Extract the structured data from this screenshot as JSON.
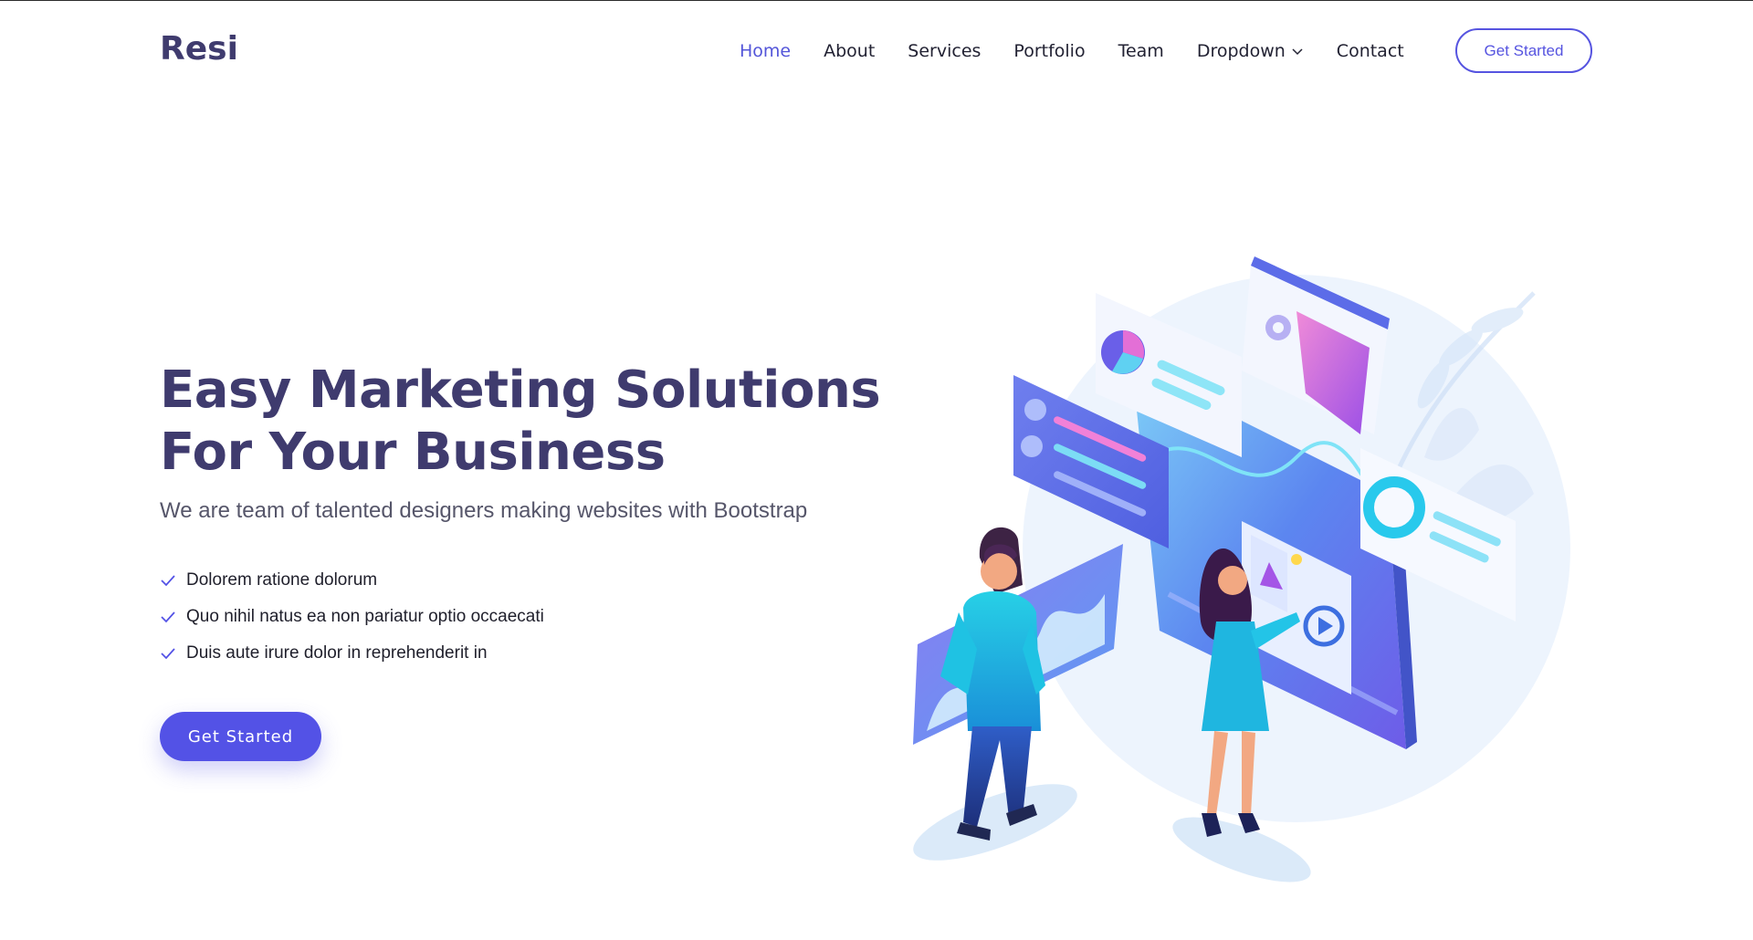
{
  "header": {
    "logo": "Resi",
    "nav": [
      {
        "label": "Home",
        "active": true
      },
      {
        "label": "About",
        "active": false
      },
      {
        "label": "Services",
        "active": false
      },
      {
        "label": "Portfolio",
        "active": false
      },
      {
        "label": "Team",
        "active": false
      },
      {
        "label": "Dropdown",
        "active": false,
        "has_dropdown": true
      },
      {
        "label": "Contact",
        "active": false
      }
    ],
    "cta_label": "Get Started"
  },
  "hero": {
    "title_line1": "Easy Marketing Solutions",
    "title_line2": "For Your Business",
    "subtitle": "We are team of talented designers making websites with Bootstrap",
    "checklist": [
      "Dolorem ratione dolorum",
      "Quo nihil natus ea non pariatur optio occaecati",
      "Duis aute irure dolor in reprehenderit in"
    ],
    "cta_label": "Get Started"
  },
  "colors": {
    "brand": "#3f3b6e",
    "accent": "#5352e6",
    "nav_active": "#5355d9",
    "text": "#222233"
  },
  "icons": {
    "checklist": "check-icon",
    "dropdown": "chevron-down-icon"
  }
}
